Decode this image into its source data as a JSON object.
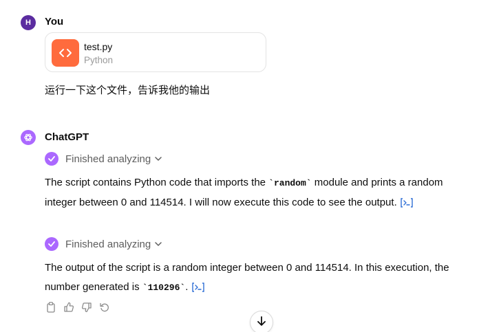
{
  "user": {
    "avatar_letter": "H",
    "name": "You",
    "file": {
      "name": "test.py",
      "type": "Python"
    },
    "message": "运行一下这个文件，告诉我他的输出"
  },
  "assistant": {
    "name": "ChatGPT",
    "status1": "Finished analyzing",
    "para1": {
      "t1": "The script contains Python code that imports the ",
      "code": "`random`",
      "t2": " module and prints a random integer between 0 and 114514. I will now execute this code to see the output. "
    },
    "status2": "Finished analyzing",
    "para2": {
      "t1": "The output of the script is a random integer between 0 and 114514. In this execution, the number generated is ",
      "code": "`110296`",
      "t2": ". "
    }
  },
  "colors": {
    "user_avatar": "#5b2ca0",
    "bot_avatar": "#ab68ff",
    "file_icon": "#ff6b3d",
    "code_link": "#2f6fd6"
  },
  "icons": {
    "file": "code-brackets-icon",
    "check": "check-icon",
    "chevron": "chevron-down-icon",
    "code_link": "code-interpreter-icon",
    "actions": [
      "copy-icon",
      "thumbs-up-icon",
      "thumbs-down-icon",
      "regenerate-icon"
    ],
    "scroll": "arrow-down-icon"
  }
}
